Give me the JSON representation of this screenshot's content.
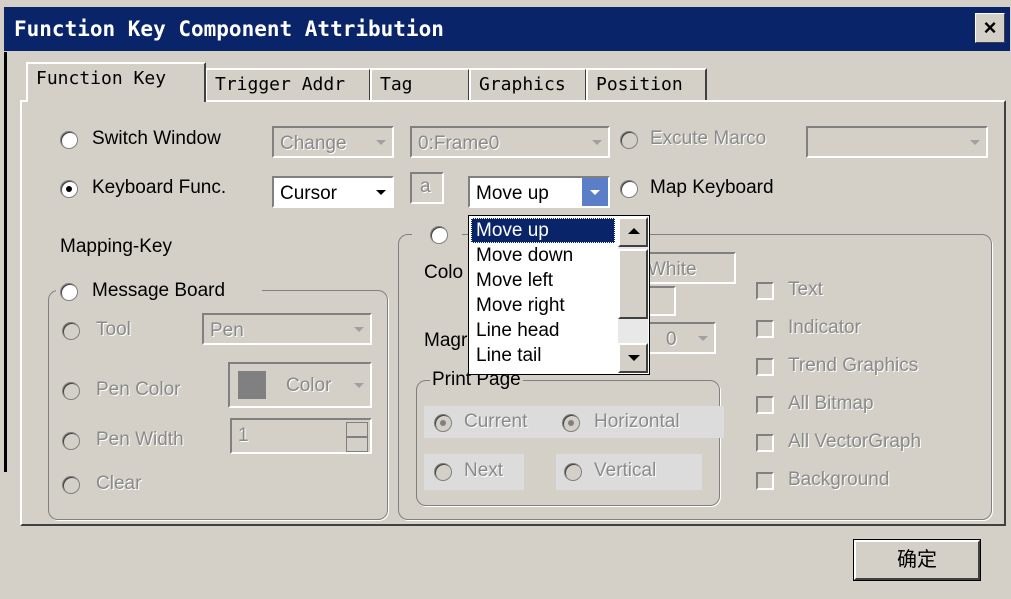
{
  "window": {
    "title": "Function Key Component Attribution",
    "close_glyph": "×"
  },
  "tabs": [
    {
      "label": "Function Key",
      "active": true
    },
    {
      "label": "Trigger Addr",
      "active": false
    },
    {
      "label": "Tag",
      "active": false
    },
    {
      "label": "Graphics",
      "active": false
    },
    {
      "label": "Position",
      "active": false
    }
  ],
  "function_key": {
    "switch_window": {
      "label": "Switch Window",
      "selected": false,
      "mode": "Change",
      "frame": "0:Frame0"
    },
    "execute_macro": {
      "label": "Excute Marco",
      "selected": false,
      "value": ""
    },
    "keyboard_func": {
      "label": "Keyboard Func.",
      "selected": true,
      "type": "Cursor",
      "char": "a",
      "action": "Move up"
    },
    "map_keyboard": {
      "label": "Map Keyboard",
      "selected": false
    },
    "mapping_key_label": "Mapping-Key",
    "action_dropdown": {
      "options": [
        "Move up",
        "Move down",
        "Move left",
        "Move right",
        "Line head",
        "Line tail"
      ],
      "selected_index": 0
    },
    "message_board": {
      "label": "Message Board",
      "selected": false,
      "tool": {
        "label": "Tool",
        "value": "Pen"
      },
      "pen_color": {
        "label": "Pen Color",
        "value": "Color",
        "swatch": "#808080"
      },
      "pen_width": {
        "label": "Pen Width",
        "value": "1"
      },
      "clear": {
        "label": "Clear"
      }
    },
    "print_group": {
      "color_label": "Colo",
      "color_value": "White",
      "magnify_label": "Magr",
      "magnify_value": "0",
      "print_page": {
        "label": "Print Page",
        "current": "Current",
        "horizontal": "Horizontal",
        "next": "Next",
        "vertical": "Vertical"
      },
      "checkboxes": [
        "Text",
        "Indicator",
        "Trend Graphics",
        "All Bitmap",
        "All VectorGraph",
        "Background"
      ]
    }
  },
  "buttons": {
    "ok": "确定"
  }
}
